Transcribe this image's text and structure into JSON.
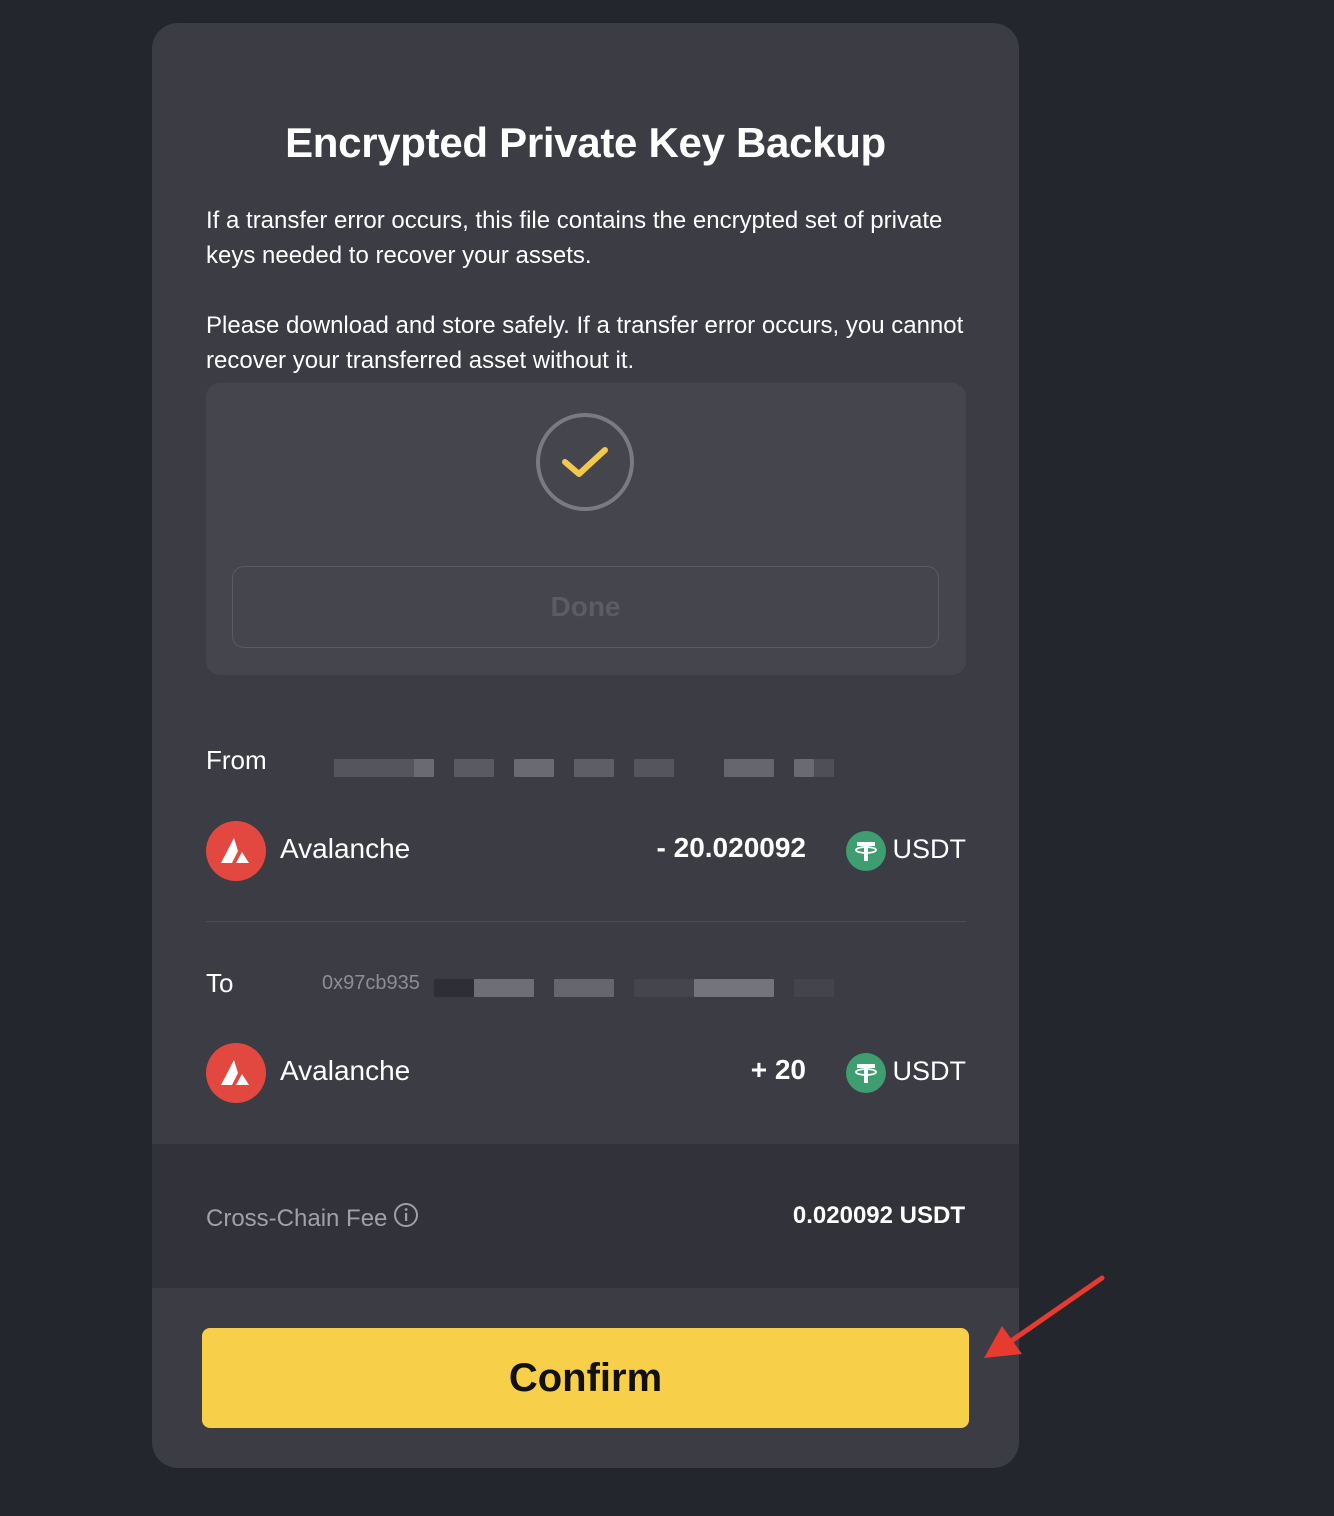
{
  "modal": {
    "title": "Encrypted Private Key Backup",
    "paragraph_1": "If a transfer error occurs, this file contains the encrypted set of private keys needed to recover your assets.",
    "paragraph_2": "Please download and store safely. If a transfer error occurs, you cannot recover your transferred asset without it.",
    "download_box": {
      "status_icon": "check-circle-icon",
      "done_label": "Done"
    },
    "from": {
      "label": "From",
      "chain": "Avalanche",
      "amount": "- 20.020092",
      "token": "USDT"
    },
    "to": {
      "label": "To",
      "address_prefix": "0x97cb935",
      "chain": "Avalanche",
      "amount": "+ 20",
      "token": "USDT"
    },
    "fee": {
      "label": "Cross-Chain Fee",
      "info_icon": "info-icon",
      "value": "0.020092 USDT"
    },
    "confirm_label": "Confirm"
  },
  "colors": {
    "background": "#24262e",
    "modal": "#3b3c44",
    "accent": "#f7cf48",
    "check": "#f2c94c",
    "avalanche": "#e2483f",
    "usdt": "#3e9e6f",
    "annotation_arrow": "#e63b2e"
  }
}
